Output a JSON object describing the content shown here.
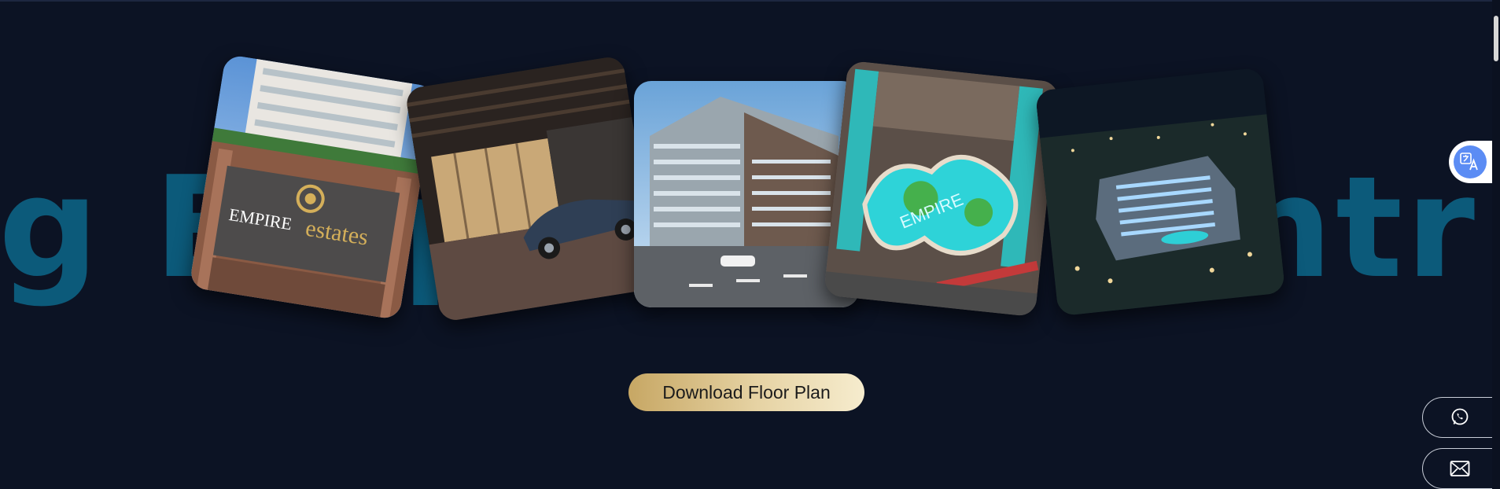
{
  "hero": {
    "marquee_left": "g Emp",
    "marquee_right": "ntr",
    "download_label": "Download Floor Plan"
  },
  "photos": [
    {
      "name": "empire-estates-sign-photo",
      "sign_line1": "EMPIRE",
      "sign_line2": "estates"
    },
    {
      "name": "luxury-car-entrance-photo"
    },
    {
      "name": "building-street-view-photo"
    },
    {
      "name": "pool-aerial-photo",
      "pool_text": "EMPIRE"
    },
    {
      "name": "night-aerial-photo"
    }
  ],
  "widgets": {
    "translate_icon": "translate-icon",
    "whatsapp_icon": "whatsapp-icon",
    "email_icon": "mail-icon"
  },
  "colors": {
    "background": "#0c1324",
    "marquee_text": "#0c5a7a",
    "button_gold": "#c7a764",
    "translate_blue": "#5b8cf4"
  }
}
